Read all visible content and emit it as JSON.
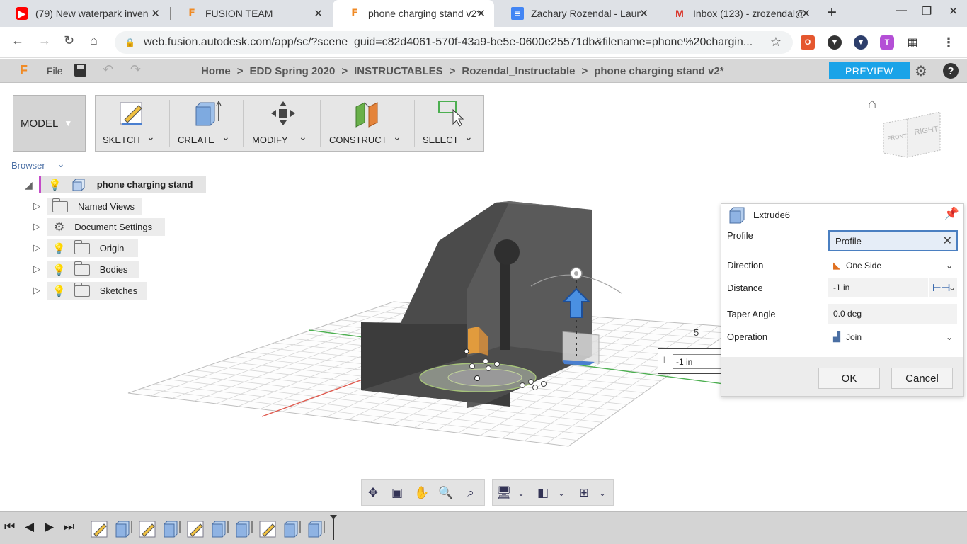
{
  "browser": {
    "tabs": [
      {
        "title": "(79) New waterpark inven",
        "icon": "youtube-icon"
      },
      {
        "title": "FUSION TEAM",
        "icon": "fusion-icon"
      },
      {
        "title": "phone charging stand v2*",
        "icon": "fusion-icon",
        "active": true
      },
      {
        "title": "Zachary Rozendal - Launc",
        "icon": "google-docs-icon"
      },
      {
        "title": "Inbox (123) - zrozendal@",
        "icon": "gmail-icon"
      }
    ],
    "url": "web.fusion.autodesk.com/app/sc/?scene_guid=c82d4061-570f-43a9-be5e-0600e25571db&filename=phone%20chargin..."
  },
  "app": {
    "file_label": "File",
    "breadcrumb": [
      "Home",
      "EDD Spring 2020",
      "INSTRUCTABLES",
      "Rozendal_Instructable",
      "phone charging stand v2*"
    ],
    "breadcrumb_sep": ">",
    "preview_label": "PREVIEW"
  },
  "workspace": {
    "model_label": "MODEL",
    "tools": [
      {
        "label": "SKETCH"
      },
      {
        "label": "CREATE"
      },
      {
        "label": "MODIFY"
      },
      {
        "label": "CONSTRUCT"
      },
      {
        "label": "SELECT"
      }
    ]
  },
  "browser_panel": {
    "title": "Browser",
    "root": "phone charging stand",
    "items": [
      {
        "label": "Named Views"
      },
      {
        "label": "Document Settings"
      },
      {
        "label": "Origin"
      },
      {
        "label": "Bodies"
      },
      {
        "label": "Sketches"
      }
    ]
  },
  "viewcube": {
    "front": "FRONT",
    "right": "RIGHT"
  },
  "viewport": {
    "grid_label": "5",
    "distance_input": "-1 in"
  },
  "dialog": {
    "title": "Extrude6",
    "profile_label": "Profile",
    "profile_value": "Profile",
    "direction_label": "Direction",
    "direction_value": "One Side",
    "distance_label": "Distance",
    "distance_value": "-1 in",
    "taper_label": "Taper Angle",
    "taper_value": "0.0 deg",
    "operation_label": "Operation",
    "operation_value": "Join",
    "ok_label": "OK",
    "cancel_label": "Cancel"
  },
  "colors": {
    "accent": "#1aa3e8",
    "fusion_orange": "#f08a24",
    "body_dark": "#5a5a5a",
    "manipulator_blue": "#2f7fd6"
  }
}
